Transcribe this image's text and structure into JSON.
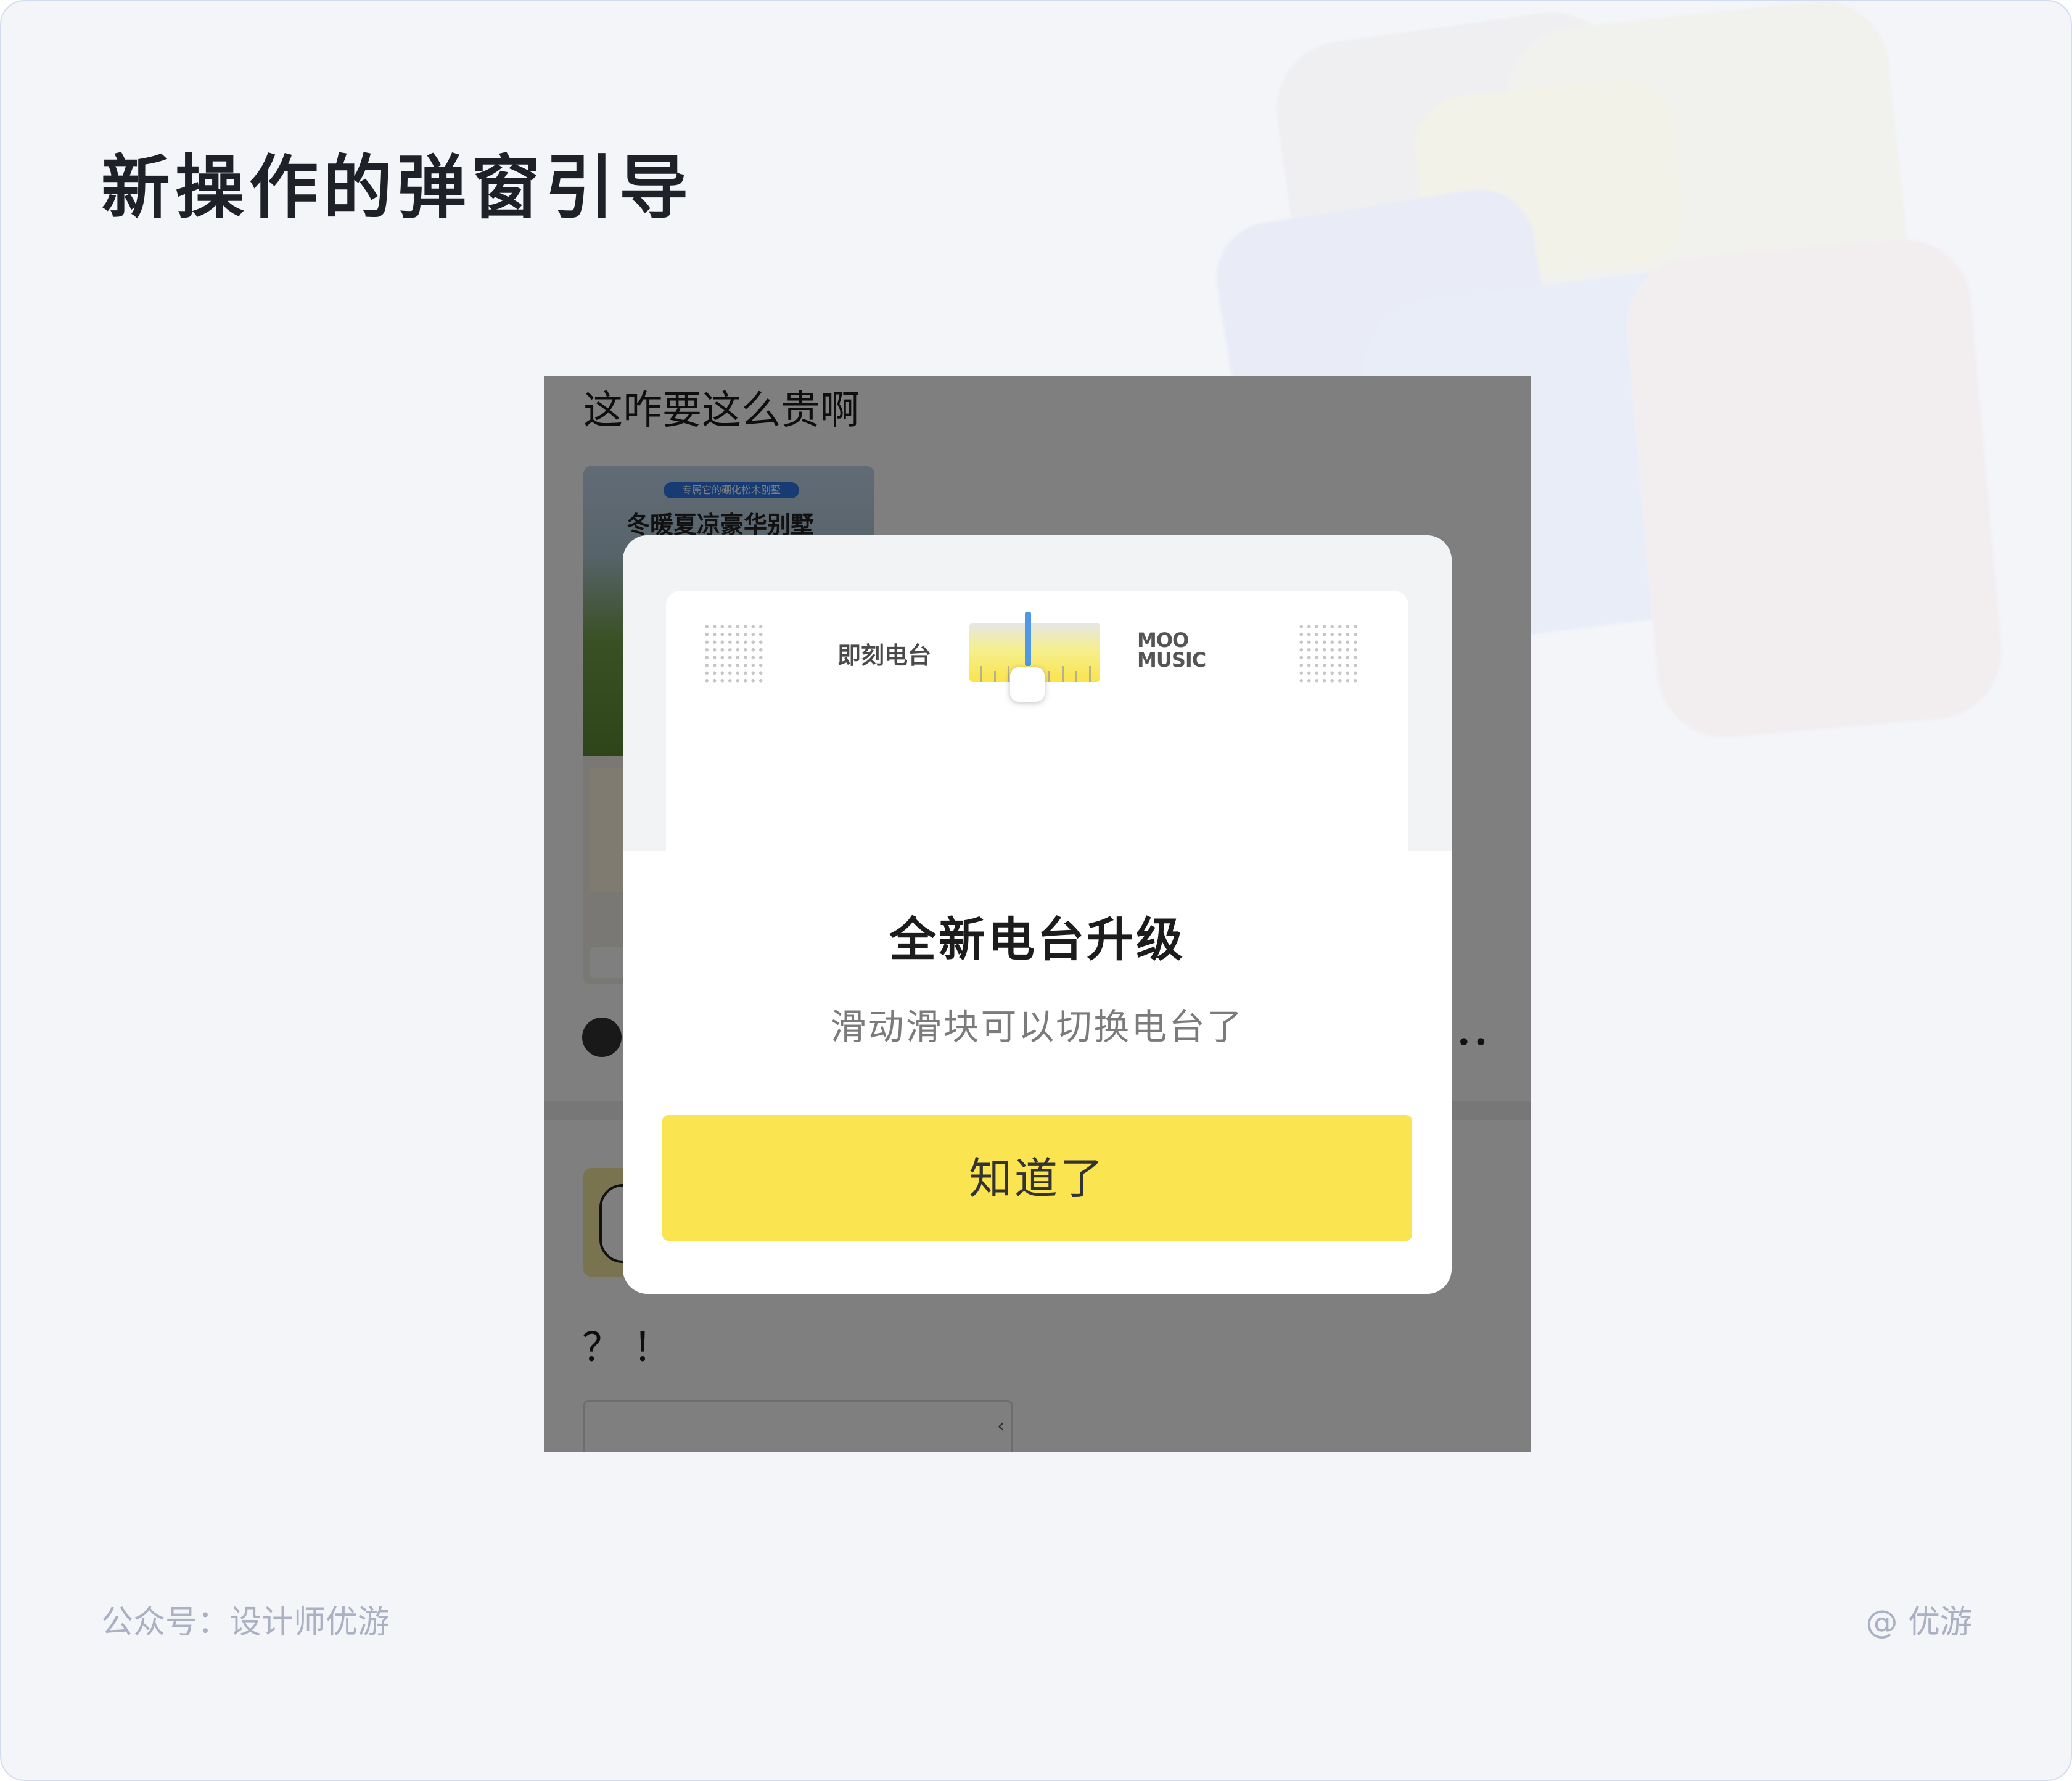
{
  "page": {
    "title": "新操作的弹窗引导",
    "footer_left": "公众号：设计师优游",
    "footer_right": "@ 优游"
  },
  "background_post": {
    "text": "这咋要这么贵啊",
    "thumbnail_chip": "专属它的硼化松木别墅",
    "thumbnail_title": "冬暖夏凉豪华别墅",
    "more_dots": "••",
    "comment_text": "？！",
    "link_arrow": "‹"
  },
  "dialog": {
    "illustration": {
      "station_left": "即刻电台",
      "station_right_line1": "MOO",
      "station_right_line2": "MUSIC",
      "accent_needle": "#4f98e6",
      "accent_dial": "#fbe44b"
    },
    "title": "全新电台升级",
    "subtitle": "滑动滑块可以切换电台了",
    "button_label": "知道了",
    "button_color": "#fae44f"
  },
  "colors": {
    "card_background": "#f3f5f9",
    "overlay": "rgba(0,0,0,0.5)"
  }
}
